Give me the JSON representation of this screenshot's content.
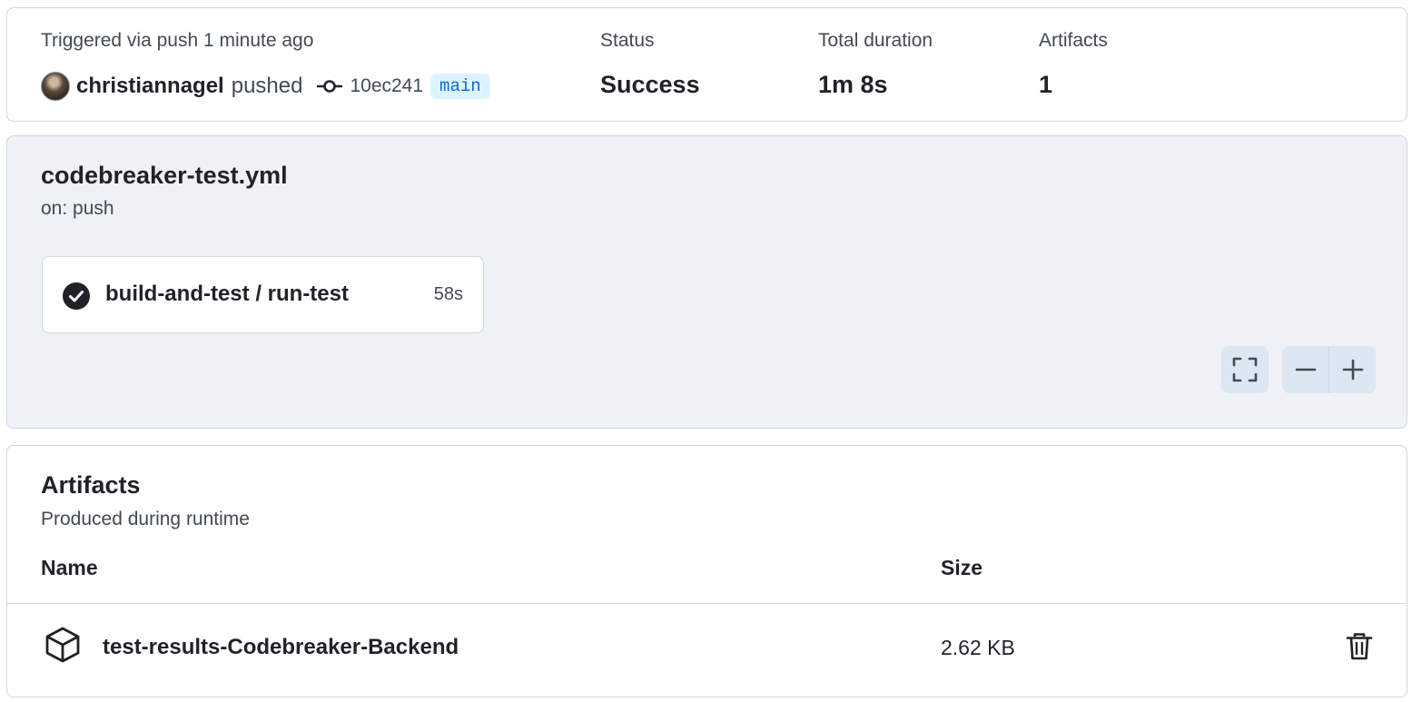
{
  "summary": {
    "trigger_text": "Triggered via push 1 minute ago",
    "actor": "christiannagel",
    "action": "pushed",
    "commit_sha": "10ec241",
    "branch": "main",
    "status_label": "Status",
    "status_value": "Success",
    "duration_label": "Total duration",
    "duration_value": "1m 8s",
    "artifacts_label": "Artifacts",
    "artifacts_value": "1"
  },
  "workflow": {
    "file_name": "codebreaker-test.yml",
    "trigger": "on: push",
    "job": {
      "name": "build-and-test / run-test",
      "duration": "58s",
      "status_icon": "check-circle-fill-icon"
    },
    "controls": [
      "fullscreen-icon",
      "zoom-out-icon",
      "zoom-in-icon"
    ]
  },
  "artifacts": {
    "title": "Artifacts",
    "subtitle": "Produced during runtime",
    "columns": [
      "Name",
      "Size"
    ],
    "rows": [
      {
        "icon": "package-icon",
        "name": "test-results-Codebreaker-Backend",
        "size": "2.62 KB",
        "action_icon": "trash-icon"
      }
    ]
  },
  "colors": {
    "text": "#1f2328",
    "muted": "#424a53",
    "border": "#d0d7de",
    "graph_bg": "#eef2f6",
    "branch_fg": "#0969da",
    "branch_bg": "#ddf4ff"
  }
}
